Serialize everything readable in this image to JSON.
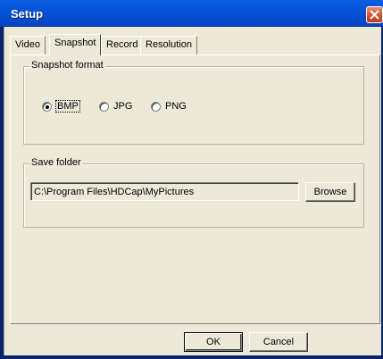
{
  "window": {
    "title": "Setup"
  },
  "tabs": [
    {
      "label": "Video"
    },
    {
      "label": "Snapshot"
    },
    {
      "label": "Record"
    },
    {
      "label": "Resolution"
    }
  ],
  "snapshot_format": {
    "legend": "Snapshot format",
    "options": [
      {
        "label": "BMP",
        "checked": true
      },
      {
        "label": "JPG",
        "checked": false
      },
      {
        "label": "PNG",
        "checked": false
      }
    ]
  },
  "save_folder": {
    "legend": "Save folder",
    "path": "C:\\Program Files\\HDCap\\MyPictures",
    "browse_label": "Browse"
  },
  "buttons": {
    "ok_label": "OK",
    "cancel_label": "Cancel"
  },
  "colors": {
    "titlebar": "#0553d6",
    "dialog_bg": "#ece9d8",
    "close_button": "#d6502d"
  }
}
